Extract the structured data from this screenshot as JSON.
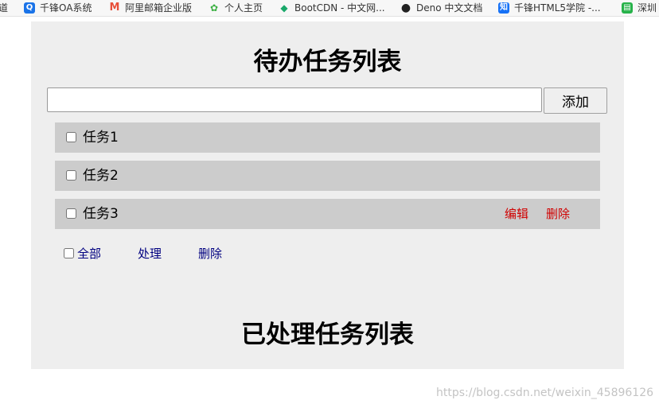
{
  "bookmarks": [
    {
      "label": "道",
      "icon": "dao-fragment-icon"
    },
    {
      "label": "千锋OA系统",
      "icon": "qianfeng-oa-icon",
      "icon_text": "Q",
      "color": "#1a73e8"
    },
    {
      "label": "阿里邮箱企业版",
      "icon": "ali-mail-icon",
      "icon_text": "M",
      "color": "#e8503a"
    },
    {
      "label": "个人主页",
      "icon": "sprout-icon",
      "icon_text": "✿",
      "color": "#3cb043"
    },
    {
      "label": "BootCDN - 中文网...",
      "icon": "bootcdn-icon",
      "icon_text": "◆",
      "color": "#1aa86a"
    },
    {
      "label": "Deno 中文文档",
      "icon": "deno-icon",
      "icon_text": "●",
      "color": "#222222"
    },
    {
      "label": "千锋HTML5学院 -...",
      "icon": "zhihu-icon",
      "icon_text": "知",
      "color": "#1772f6"
    },
    {
      "label": "深圳",
      "icon": "green-doc-icon",
      "icon_text": "▤",
      "color": "#27b24a"
    }
  ],
  "todo": {
    "title": "待办任务列表",
    "input_value": "",
    "add_label": "添加",
    "tasks": [
      {
        "label": "任务1",
        "checked": false
      },
      {
        "label": "任务2",
        "checked": false
      },
      {
        "label": "任务3",
        "checked": false,
        "edit_label": "编辑",
        "delete_label": "删除"
      }
    ],
    "footer": {
      "select_all_label": "全部",
      "process_label": "处理",
      "delete_label": "删除"
    }
  },
  "done": {
    "title": "已处理任务列表"
  },
  "watermark": "https://blog.csdn.net/weixin_45896126",
  "colors": {
    "panel_bg": "#eeeeee",
    "row_bg": "#cccccc",
    "row_action": "#d00000",
    "footer_link": "#000080"
  }
}
